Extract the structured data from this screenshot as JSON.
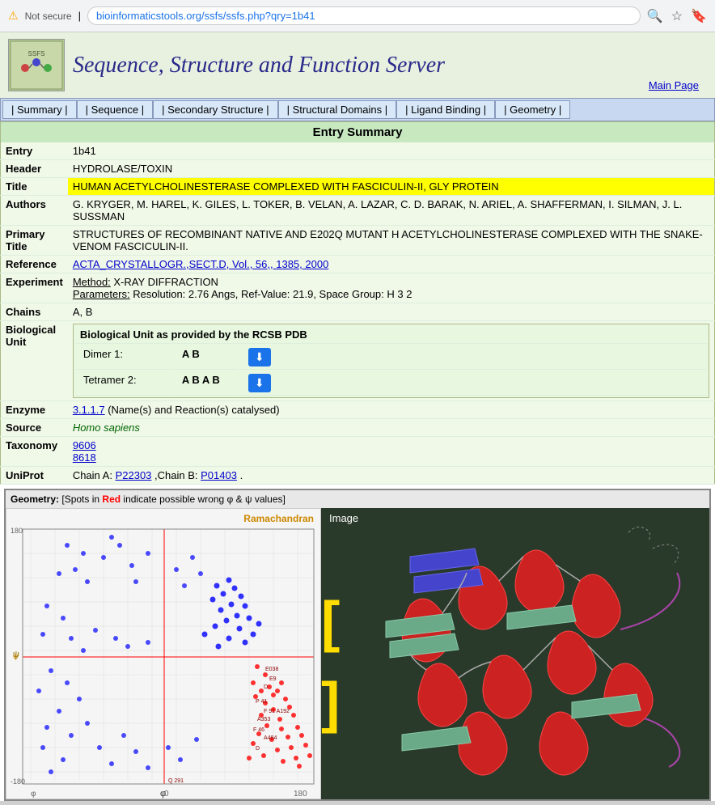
{
  "browser": {
    "warning": "⚠",
    "not_secure": "Not secure",
    "separator": "|",
    "url_normal": "",
    "url_highlight": "bioinformaticstools.org/ssfs/ssfs.php?qry=1b41",
    "search_icon": "🔍",
    "star_icon": "☆",
    "ext_icon": "🔖"
  },
  "site": {
    "title": "Sequence, Structure and Function Server",
    "main_page": "Main Page"
  },
  "nav": {
    "items": [
      "| Summary |",
      "| Sequence |",
      "| Secondary Structure |",
      "| Structural Domains |",
      "| Ligand Binding |",
      "| Geometry |"
    ]
  },
  "entry": {
    "section_title": "Entry Summary",
    "entry_label": "Entry",
    "entry_value": "1b41",
    "header_label": "Header",
    "header_value": "HYDROLASE/TOXIN",
    "title_label": "Title",
    "title_value": "HUMAN ACETYLCHOLINESTERASE COMPLEXED WITH FASCICULIN-II, GLY PROTEIN",
    "authors_label": "Authors",
    "authors_value": "G. KRYGER, M. HAREL, K. GILES, L. TOKER, B. VELAN, A. LAZAR, C. D. BARAK, N. ARIEL, A. SHAFFERMAN, I. SILMAN, J. L. SUSSMAN",
    "primary_title_label": "Primary Title",
    "primary_title_value": "STRUCTURES OF RECOMBINANT NATIVE AND E202Q MUTANT H ACETYLCHOLINESTERASE COMPLEXED WITH THE SNAKE-VENOM FASCICULIN-II.",
    "reference_label": "Reference",
    "reference_value": "ACTA_CRYSTALLOGR.,SECT.D, Vol., 56,, 1385, 2000",
    "experiment_label": "Experiment",
    "method": "Method: X-RAY DIFFRACTION",
    "parameters": "Parameters: Resolution: 2.76 Angs, Ref-Value: 21.9, Space Group: H 3 2",
    "chains_label": "Chains",
    "chains_value": "A, B",
    "bio_unit_header": "Biological Unit as provided by the RCSB PDB",
    "dimer_label": "Dimer 1:",
    "dimer_value": "A B",
    "tetramer_label": "Tetramer 2:",
    "tetramer_value": "A B A B",
    "enzyme_label": "Enzyme",
    "enzyme_link": "3.1.1.7",
    "enzyme_suffix": " (Name(s) and Reaction(s) catalysed)",
    "source_label": "Source",
    "source_value": "Homo sapiens",
    "taxonomy_label": "Taxonomy",
    "taxonomy_1": "9606",
    "taxonomy_2": "8618",
    "uniprot_label": "UniProt",
    "uniprot_prefix": "Chain A: ",
    "uniprot_chain_a": "P22303",
    "uniprot_mid": ",Chain B: ",
    "uniprot_chain_b": "P01403",
    "uniprot_suffix": "."
  },
  "geometry": {
    "header": "Geometry:",
    "spots_note": "[Spots in",
    "red_text": "Red",
    "spots_note2": "indicate possible wrong φ & ψ values]",
    "ramachandran_label": "Ramachandran",
    "image_label": "Image"
  }
}
